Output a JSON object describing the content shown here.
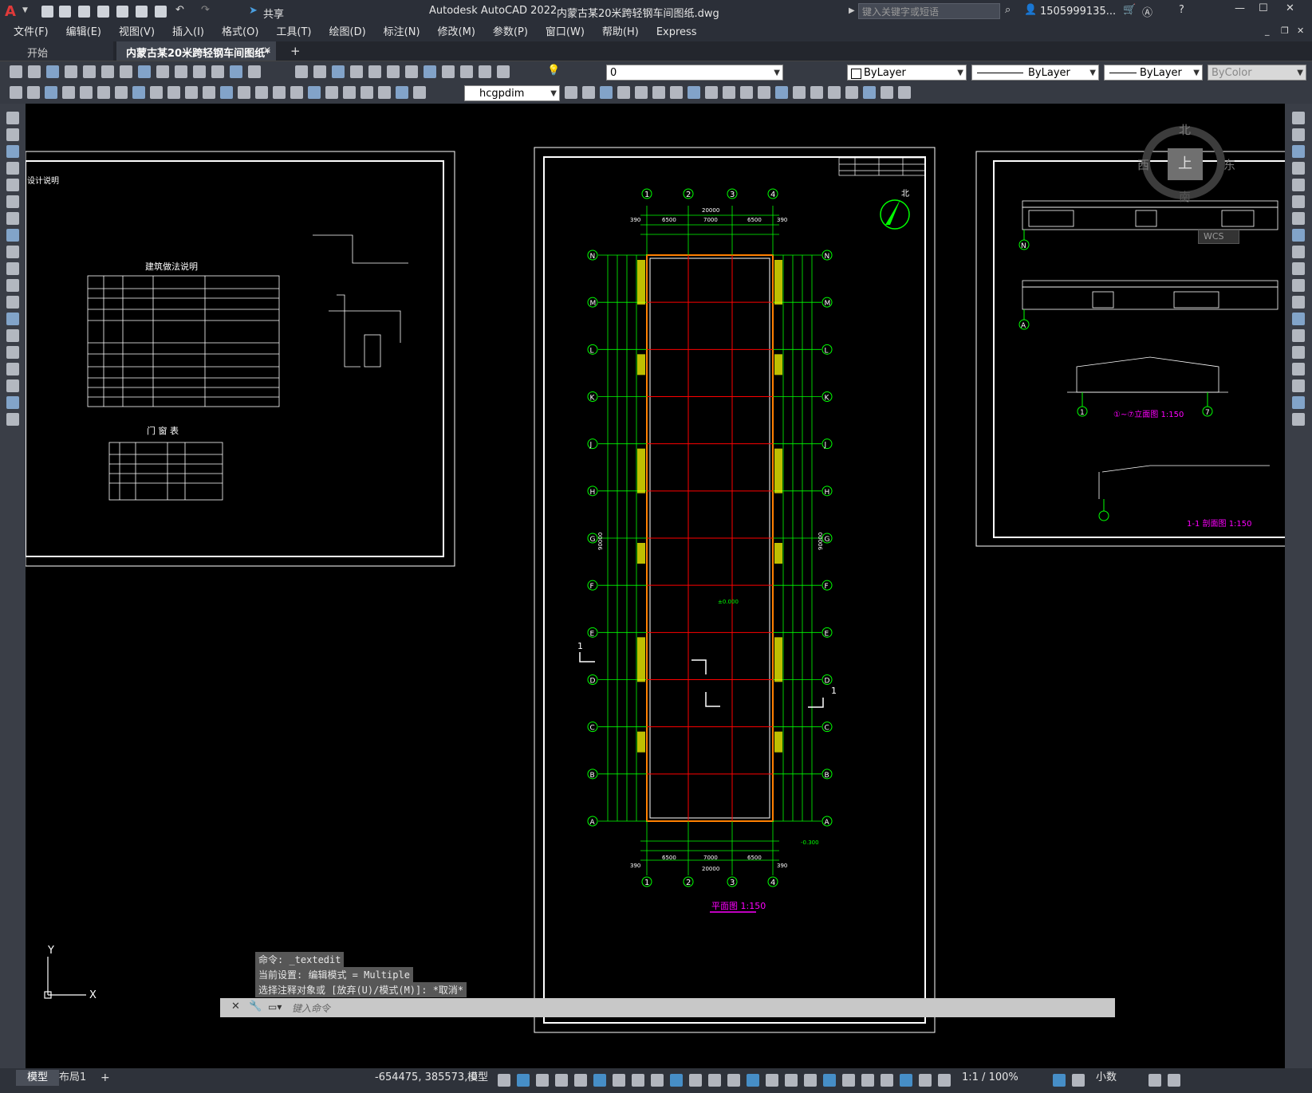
{
  "app": {
    "title": "Autodesk AutoCAD 2022",
    "doc_title": "内蒙古某20米跨轻钢车间图纸.dwg",
    "search_placeholder": "键入关键字或短语",
    "user": "1505999135...",
    "share_label": "共享"
  },
  "menu": [
    "文件(F)",
    "编辑(E)",
    "视图(V)",
    "插入(I)",
    "格式(O)",
    "工具(T)",
    "绘图(D)",
    "标注(N)",
    "修改(M)",
    "参数(P)",
    "窗口(W)",
    "帮助(H)",
    "Express"
  ],
  "tabs": {
    "start": "开始",
    "active": "内蒙古某20米跨轻钢车间图纸*",
    "add": "+"
  },
  "toolbar": {
    "layer_value": "0",
    "color_value": "ByLayer",
    "linetype_value": "ByLayer",
    "lineweight_value": "ByLayer",
    "plotstyle_value": "ByColor",
    "dimstyle_value": "hcgpdim"
  },
  "viewcube": {
    "north": "北",
    "south": "南",
    "east": "东",
    "west": "西",
    "top": "上",
    "wcs": "WCS"
  },
  "drawing": {
    "left_sheet_title": "设计说明",
    "left_table_title": "建筑做法说明",
    "door_table_title": "门 窗 表",
    "plan_title": "平面图 1:150",
    "plan_total_width": "20000",
    "plan_bays_top": [
      "6500",
      "7000",
      "6500"
    ],
    "plan_offsets": "390",
    "plan_level": "±0.000",
    "plan_level_out": "-0.300",
    "plan_total_length": "90000",
    "col_axes": [
      "1",
      "2",
      "3",
      "4"
    ],
    "row_axes": [
      "N",
      "M",
      "L",
      "K",
      "J",
      "H",
      "G",
      "F",
      "E",
      "D",
      "C",
      "B",
      "A"
    ],
    "section_mark": "1",
    "right_elev_title": "①~⑦立面图 1:150",
    "right_section_title": "1-1 剖面图 1:150",
    "right_axis_n": "N",
    "right_axis_a": "A",
    "right_axis_1": "1",
    "right_axis_7": "7",
    "north_label": "北"
  },
  "ucs": {
    "x": "X",
    "y": "Y"
  },
  "command": {
    "line1": "命令: _textedit",
    "line2": "当前设置: 编辑模式 = Multiple",
    "line3": "选择注释对象或 [放弃(U)/模式(M)]: *取消*",
    "input_placeholder": "键入命令"
  },
  "layout_tabs": [
    "模型",
    "布局1",
    "+"
  ],
  "status": {
    "coords": "-654475, 385573, 0",
    "space": "模型",
    "scale": "1:1 / 100%",
    "units": "小数"
  },
  "colors": {
    "grid_green": "#00ff00",
    "axis_red": "#ff0000",
    "wall_yellow": "#ffff00",
    "magenta": "#ff00ff",
    "white": "#ffffff"
  }
}
